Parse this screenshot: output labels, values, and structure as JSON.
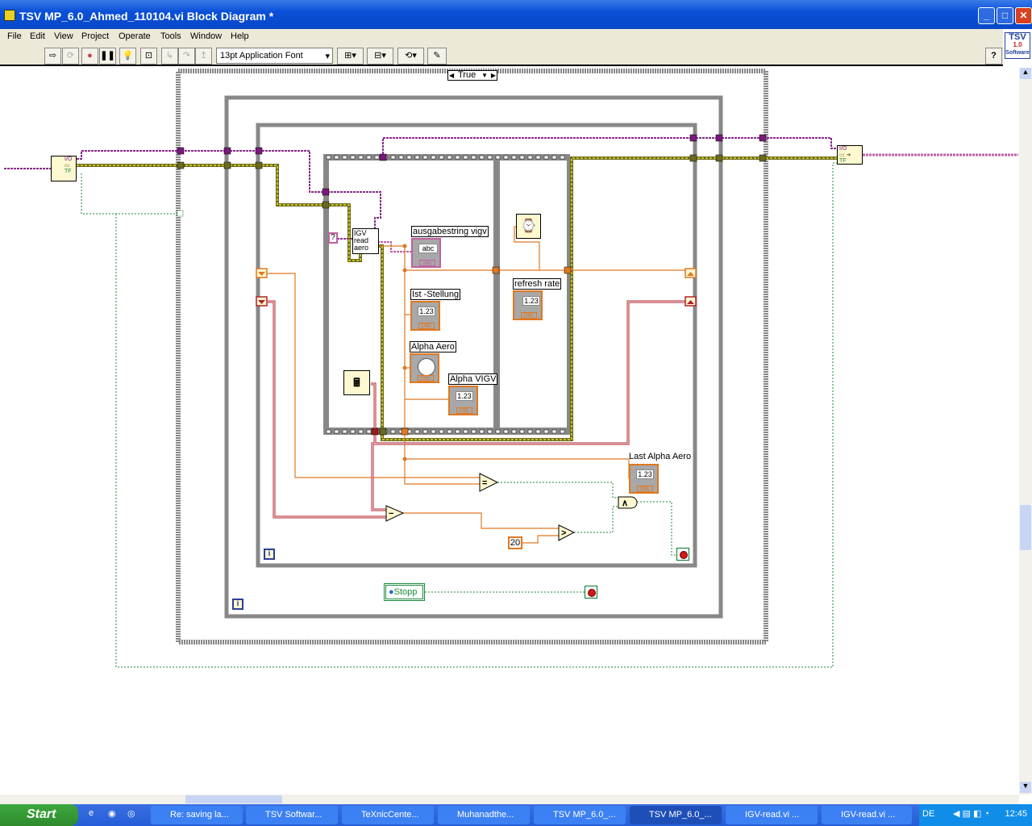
{
  "window": {
    "title": "TSV MP_6.0_Ahmed_110104.vi Block Diagram *"
  },
  "menu": [
    "File",
    "Edit",
    "View",
    "Project",
    "Operate",
    "Tools",
    "Window",
    "Help"
  ],
  "toolbar": {
    "font": "13pt Application Font",
    "help": "?"
  },
  "logo": {
    "line1": "TSV",
    "line2": "1.0",
    "line3": "Software"
  },
  "diagram": {
    "case_selector": "True",
    "igv_subvi": [
      "IGV",
      "read",
      "aero"
    ],
    "const_unknown": "?",
    "labels": {
      "ausgabestring": "ausgabestring vigv",
      "ist": "Ist -Stellung",
      "alpha_aero": "Alpha  Aero",
      "alpha_vigv": "Alpha VIGV",
      "refresh": "refresh rate",
      "last_alpha": "Last Alpha Aero"
    },
    "indicator_value": "1.23",
    "indicator_type": "DBL",
    "string_value": "abc",
    "string_type": "abc",
    "const_20": "20",
    "stopp": "Stopp",
    "iteration": "i",
    "io_label": "I/O",
    "tf_label": "TF",
    "ops": {
      "equal": "=",
      "subtract": "−",
      "greater": ">",
      "and": "∧"
    }
  },
  "taskbar": {
    "start": "Start",
    "tasks": [
      "Re: saving la...",
      "TSV Softwar...",
      "TeXnicCente...",
      "Muhanadthe...",
      "TSV MP_6.0_...",
      "TSV MP_6.0_...",
      "IGV-read.vi ...",
      "IGV-read.vi ..."
    ],
    "active_index": 5,
    "lang": "DE",
    "clock": "12:45"
  }
}
